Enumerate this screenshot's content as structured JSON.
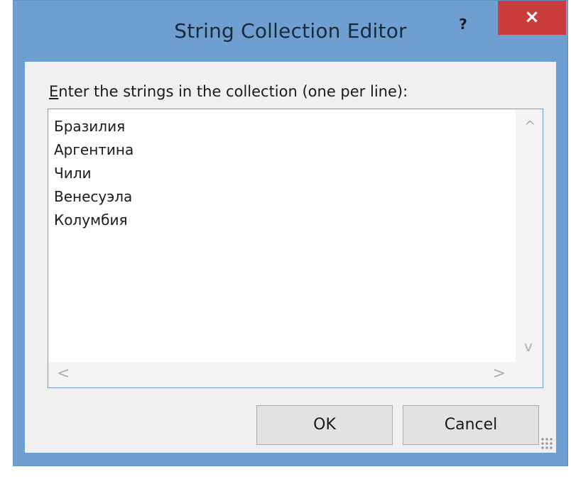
{
  "window": {
    "title": "String Collection Editor",
    "help_label": "?",
    "close_label": "×"
  },
  "prompt": {
    "accelerator": "E",
    "text": "nter the strings in the collection (one per line):"
  },
  "strings": [
    "Бразилия",
    "Аргентина",
    "Чили",
    "Венесуэла",
    "Колумбия"
  ],
  "scroll": {
    "up": "^",
    "down": "v",
    "left": "<",
    "right": ">"
  },
  "buttons": {
    "ok": "OK",
    "cancel": "Cancel"
  }
}
